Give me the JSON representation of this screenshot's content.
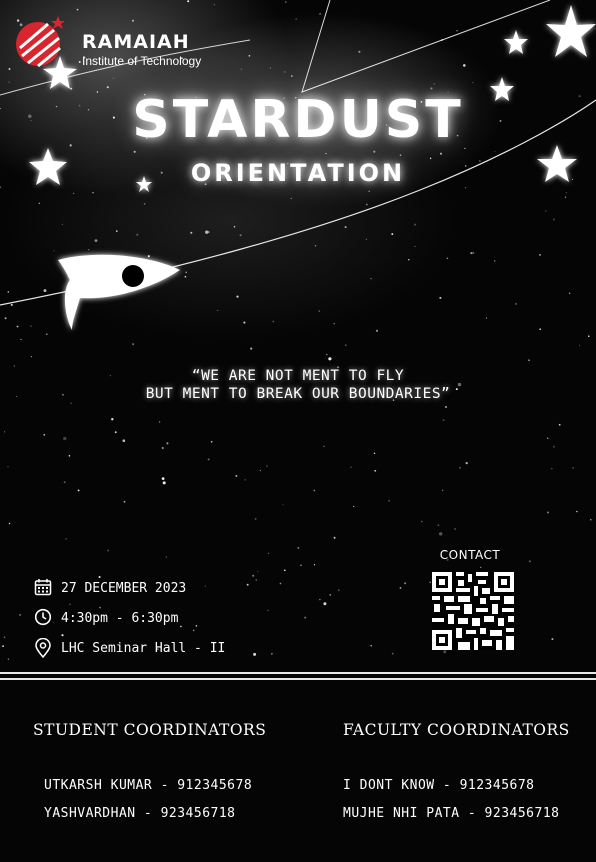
{
  "institution": {
    "name": "RAMAIAH",
    "subtitle": "Institute of Technology",
    "logo_icon": "ramaiah-logo-icon",
    "logo_color": "#d8262e"
  },
  "event": {
    "title": "STARDUST",
    "subtitle": "ORIENTATION"
  },
  "quote": {
    "line1": "“WE ARE NOT MENT TO FLY",
    "line2": "BUT MENT TO BREAK OUR BOUNDARIES”"
  },
  "details": {
    "date": "27 DECEMBER 2023",
    "time": "4:30pm - 6:30pm",
    "venue": "LHC Seminar Hall - II",
    "icons": [
      "calendar-icon",
      "clock-icon",
      "location-pin-icon"
    ]
  },
  "contact": {
    "label": "CONTACT",
    "qr_icon": "qr-code-icon"
  },
  "student_coordinators": {
    "heading": "STUDENT COORDINATORS",
    "people": [
      "UTKARSH KUMAR - 912345678",
      "YASHVARDHAN - 923456718"
    ]
  },
  "faculty_coordinators": {
    "heading": "FACULTY COORDINATORS",
    "people": [
      "I DONT KNOW - 912345678",
      "MUJHE NHI PATA - 923456718"
    ]
  },
  "colors": {
    "background": "#050505",
    "text": "#ffffff",
    "accent": "#d8262e"
  }
}
